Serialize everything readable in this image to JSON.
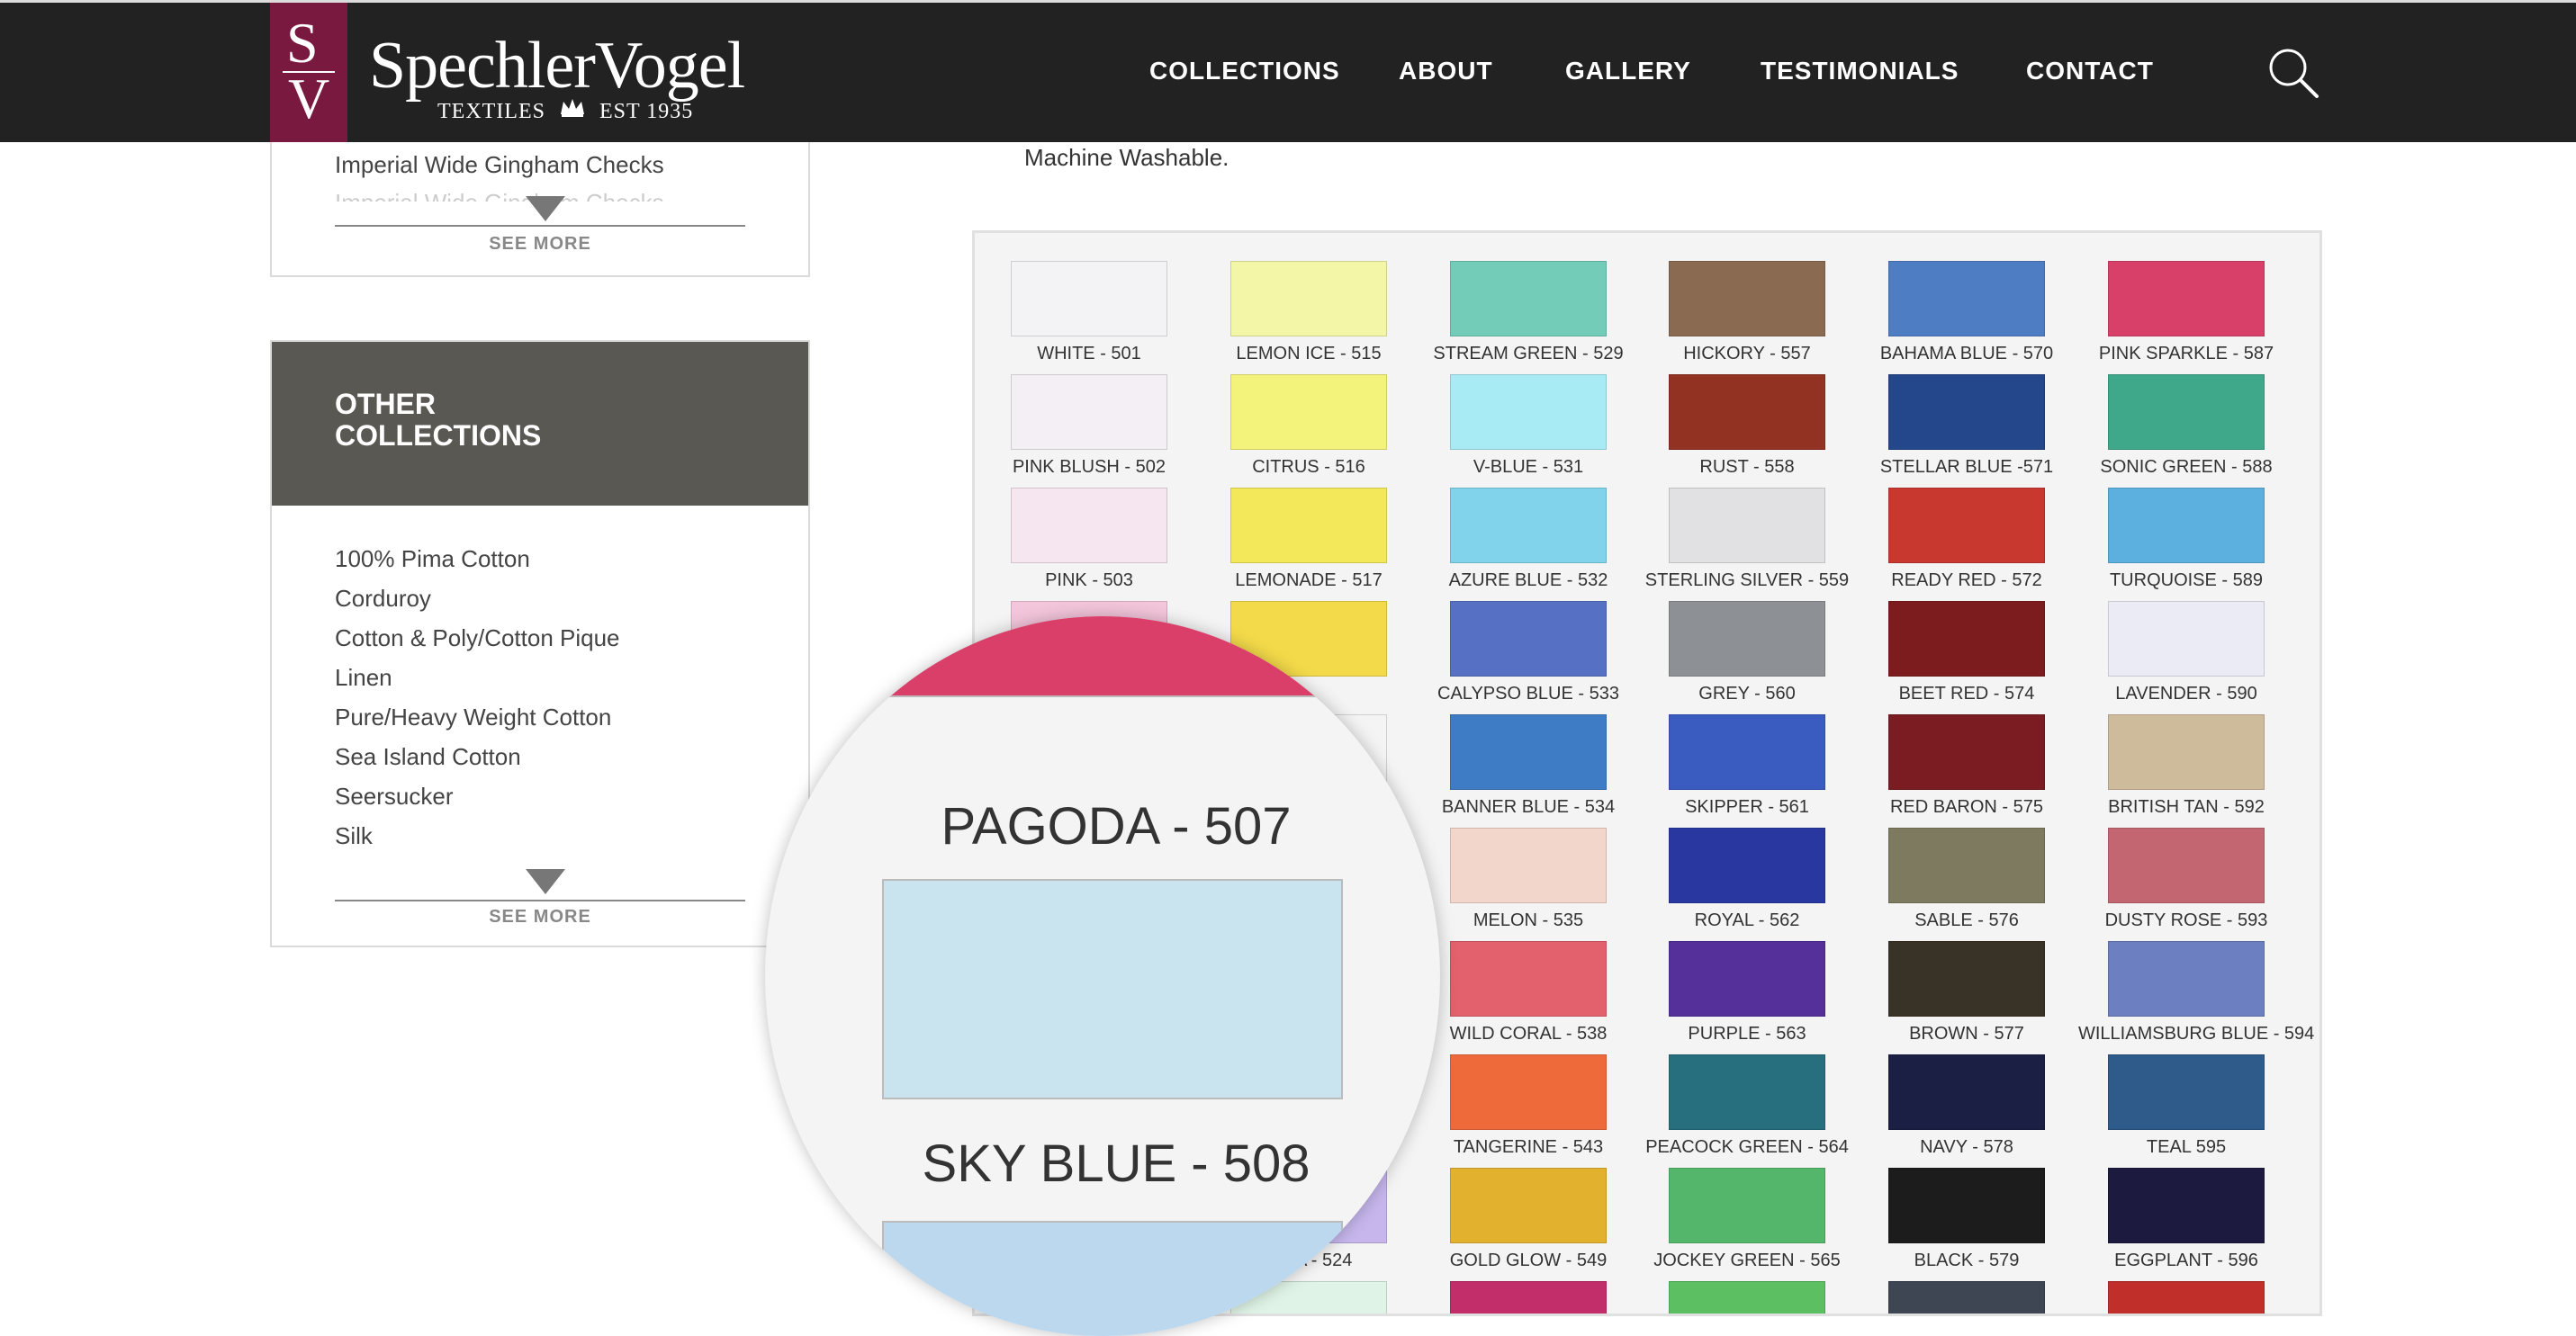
{
  "header": {
    "logo_letters": [
      "S",
      "V"
    ],
    "brand_name": "SpechlerVogel",
    "brand_tag_left": "TEXTILES",
    "brand_tag_right": "EST 1935",
    "nav": [
      "COLLECTIONS",
      "ABOUT",
      "GALLERY",
      "TESTIMONIALS",
      "CONTACT"
    ]
  },
  "sidebar": {
    "top_card": {
      "visible_item": "Imperial Wide Gingham Checks",
      "see_more": "SEE MORE"
    },
    "other_collections": {
      "title_line1": "OTHER",
      "title_line2": "COLLECTIONS",
      "items": [
        "100% Pima Cotton",
        "Corduroy",
        "Cotton & Poly/Cotton Pique",
        "Linen",
        "Pure/Heavy Weight Cotton",
        "Sea Island Cotton",
        "Seersucker",
        "Silk"
      ],
      "see_more": "SEE MORE"
    }
  },
  "main": {
    "description": "Machine Washable."
  },
  "chart_data": {
    "type": "table",
    "swatches": [
      {
        "label": "WHITE - 501",
        "color": "#f3f3f6"
      },
      {
        "label": "LEMON ICE - 515",
        "color": "#f2f6a6"
      },
      {
        "label": "STREAM GREEN - 529",
        "color": "#72ccb8"
      },
      {
        "label": "HICKORY - 557",
        "color": "#8a6b52"
      },
      {
        "label": "BAHAMA BLUE - 570",
        "color": "#4e7dc4"
      },
      {
        "label": "PINK SPARKLE - 587",
        "color": "#d8406a"
      },
      {
        "label": "PINK BLUSH - 502",
        "color": "#f3eff4"
      },
      {
        "label": "CITRUS - 516",
        "color": "#f3f27a"
      },
      {
        "label": "V-BLUE - 531",
        "color": "#a9ebf4"
      },
      {
        "label": "RUST - 558",
        "color": "#923223"
      },
      {
        "label": "STELLAR BLUE -571",
        "color": "#24468a"
      },
      {
        "label": "SONIC GREEN - 588",
        "color": "#3fa88a"
      },
      {
        "label": "PINK - 503",
        "color": "#f6e6ef"
      },
      {
        "label": "LEMONADE - 517",
        "color": "#f3e85a"
      },
      {
        "label": "AZURE BLUE - 532",
        "color": "#80d3ea"
      },
      {
        "label": "STERLING SILVER - 559",
        "color": "#e1e1e3"
      },
      {
        "label": "READY RED - 572",
        "color": "#c8382f"
      },
      {
        "label": "TURQUOISE - 589",
        "color": "#5cb0e0"
      },
      {
        "label": "",
        "color": "#f4c6dc"
      },
      {
        "label": "",
        "color": "#f3da4a"
      },
      {
        "label": "CALYPSO BLUE - 533",
        "color": "#5670c4"
      },
      {
        "label": "GREY - 560",
        "color": "#8d9094"
      },
      {
        "label": "BEET RED - 574",
        "color": "#7c1c1e"
      },
      {
        "label": "LAVENDER - 590",
        "color": "#ebebf5"
      },
      {
        "label": "",
        "color": "#f4f4f4"
      },
      {
        "label": "",
        "color": "#f4f4f4"
      },
      {
        "label": "BANNER BLUE - 534",
        "color": "#3f7cc6"
      },
      {
        "label": "SKIPPER - 561",
        "color": "#3a5bc0"
      },
      {
        "label": "RED BARON - 575",
        "color": "#7a1c22"
      },
      {
        "label": "BRITISH TAN - 592",
        "color": "#cdbb9c"
      },
      {
        "label": "",
        "color": "#f4f4f4"
      },
      {
        "label": "",
        "color": "#f4f4f4"
      },
      {
        "label": "MELON - 535",
        "color": "#f2d6cc"
      },
      {
        "label": "ROYAL - 562",
        "color": "#2838a0"
      },
      {
        "label": "SABLE - 576",
        "color": "#7d7a60"
      },
      {
        "label": "DUSTY ROSE - 593",
        "color": "#c46672"
      },
      {
        "label": "",
        "color": "#f4f4f4"
      },
      {
        "label": "",
        "color": "#f4f4f4"
      },
      {
        "label": "WILD CORAL - 538",
        "color": "#e2616c"
      },
      {
        "label": "PURPLE - 563",
        "color": "#55309a"
      },
      {
        "label": "BROWN - 577",
        "color": "#393226"
      },
      {
        "label": "WILLIAMSBURG BLUE - 594",
        "color": "#6c7fc1"
      },
      {
        "label": "",
        "color": "#f4f4f4"
      },
      {
        "label": "",
        "color": "#f4f4f4"
      },
      {
        "label": "TANGERINE - 543",
        "color": "#ee6a3a"
      },
      {
        "label": "PEACOCK GREEN - 564",
        "color": "#276e7e"
      },
      {
        "label": "NAVY - 578",
        "color": "#1c1f44"
      },
      {
        "label": "TEAL 595",
        "color": "#2e5b8a"
      },
      {
        "label": "",
        "color": "#f4f4f4"
      },
      {
        "label": "ERIA - 524",
        "color": "#c6b6ec"
      },
      {
        "label": "GOLD GLOW - 549",
        "color": "#e2b22e"
      },
      {
        "label": "JOCKEY GREEN - 565",
        "color": "#53b66a"
      },
      {
        "label": "BLACK - 579",
        "color": "#1c1c1c"
      },
      {
        "label": "EGGPLANT - 596",
        "color": "#1c1a3e"
      },
      {
        "label": "",
        "color": "#f4f4f4"
      },
      {
        "label": "",
        "color": "#dff3e6"
      },
      {
        "label": "",
        "color": "#c22e6a"
      },
      {
        "label": "",
        "color": "#5cc062"
      },
      {
        "label": "",
        "color": "#3e4654"
      },
      {
        "label": "",
        "color": "#c02f2a"
      }
    ],
    "magnified": [
      {
        "label": "",
        "color": "#da3f6a"
      },
      {
        "label": "PAGODA - 507",
        "color": "#c9e4ee"
      },
      {
        "label": "SKY BLUE - 508",
        "color": "#bcd8ef"
      }
    ]
  }
}
